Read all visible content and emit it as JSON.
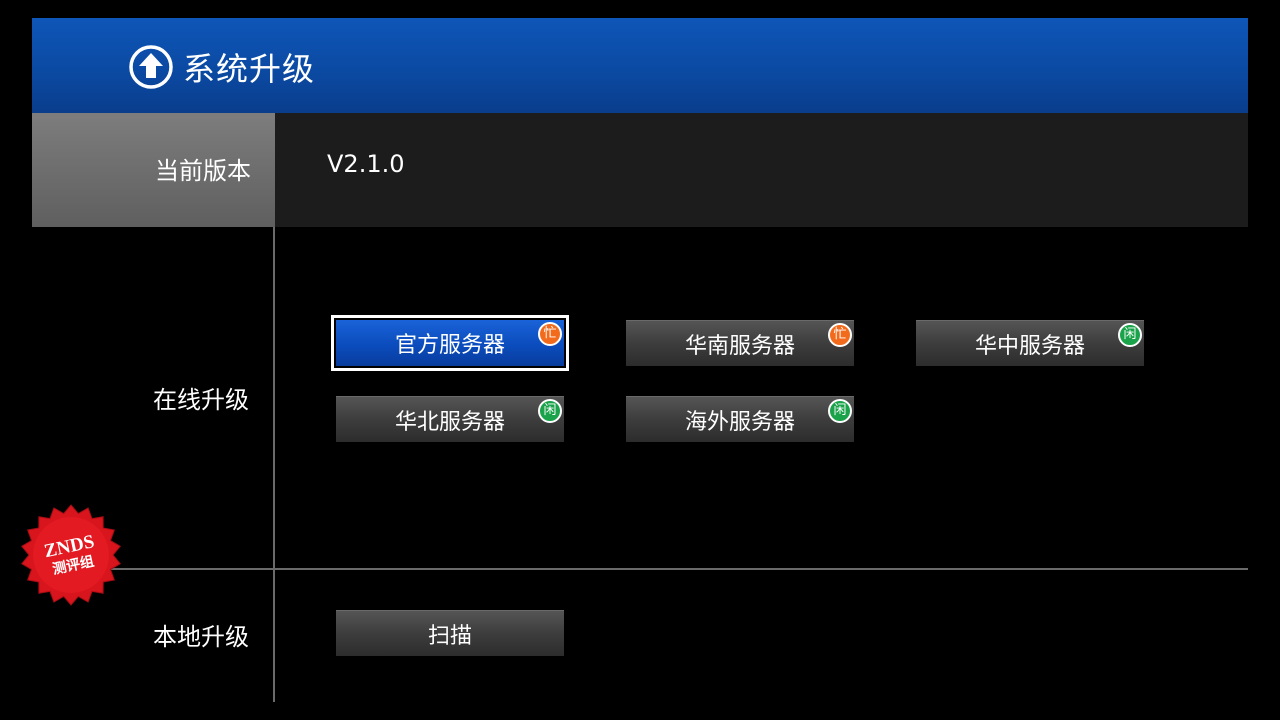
{
  "header": {
    "title": "系统升级",
    "icon": "upload-arrow-circle-icon"
  },
  "current_version": {
    "label": "当前版本",
    "value": "V2.1.0"
  },
  "online_upgrade": {
    "label": "在线升级",
    "servers": [
      {
        "label": "官方服务器",
        "status": "忙",
        "status_color": "#f26b1d",
        "selected": true
      },
      {
        "label": "华南服务器",
        "status": "忙",
        "status_color": "#f26b1d",
        "selected": false
      },
      {
        "label": "华中服务器",
        "status": "闲",
        "status_color": "#1aa34a",
        "selected": false
      },
      {
        "label": "华北服务器",
        "status": "闲",
        "status_color": "#1aa34a",
        "selected": false
      },
      {
        "label": "海外服务器",
        "status": "闲",
        "status_color": "#1aa34a",
        "selected": false
      }
    ]
  },
  "local_upgrade": {
    "label": "本地升级",
    "scan_label": "扫描"
  },
  "watermark": {
    "line1": "ZNDS",
    "line2": "测评组",
    "color": "#d8141c"
  },
  "colors": {
    "header_blue": "#0b4aa3",
    "selected_blue": "#0b4cbd",
    "busy": "#f26b1d",
    "idle": "#1aa34a"
  }
}
